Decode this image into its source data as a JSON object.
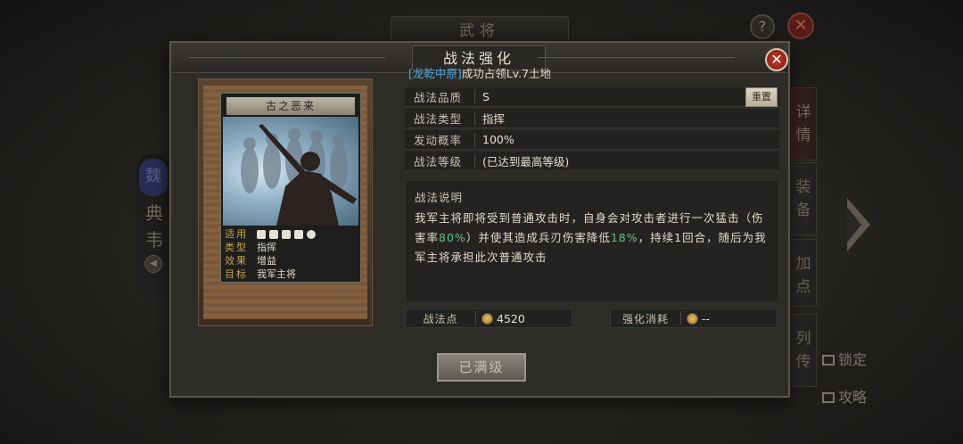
{
  "background": {
    "title": "武将",
    "help": "?",
    "close": "✕",
    "left_badge": "魏",
    "left_label": "典韦",
    "right_tabs": [
      "详情",
      "装备",
      "加点",
      "列传"
    ],
    "side_links": [
      "锁定",
      "攻略"
    ]
  },
  "dialog": {
    "title": "战法强化",
    "subtitle_link": "[龙乾中原]",
    "subtitle_rest": "成功占领Lv.7土地",
    "close": "✕"
  },
  "card": {
    "name": "古之恶来",
    "rows": [
      {
        "k": "适用",
        "v": ""
      },
      {
        "k": "类型",
        "v": "指挥"
      },
      {
        "k": "效果",
        "v": "增益"
      },
      {
        "k": "目标",
        "v": "我军主将"
      }
    ],
    "troop_icons": [
      "cavalry-icon",
      "shield-icon",
      "bow-icon",
      "spear-icon",
      "siege-icon"
    ]
  },
  "info": {
    "quality_label": "战法品质",
    "quality_value": "S",
    "reset_label": "重置",
    "type_label": "战法类型",
    "type_value": "指挥",
    "rate_label": "发动概率",
    "rate_value": "100%",
    "level_label": "战法等级",
    "level_value": "(已达到最高等级)"
  },
  "description": {
    "title": "战法说明",
    "part1": "我军主将即将受到普通攻击时，自身会对攻击者进行一次猛击（伤害率",
    "val1": "80%",
    "part2": "）并使其造成兵刃伤害降低",
    "val2": "18%",
    "part3": "，持续1回合，随后为我军主将承担此次普通攻击"
  },
  "points": {
    "label": "战法点",
    "value": "4520",
    "cost_label": "强化消耗",
    "cost_value": "--"
  },
  "max_button": "已满级",
  "colors": {
    "highlight_blue": "#4fa6d8",
    "highlight_green": "#5ec08a",
    "close_red": "#c03a2e"
  }
}
